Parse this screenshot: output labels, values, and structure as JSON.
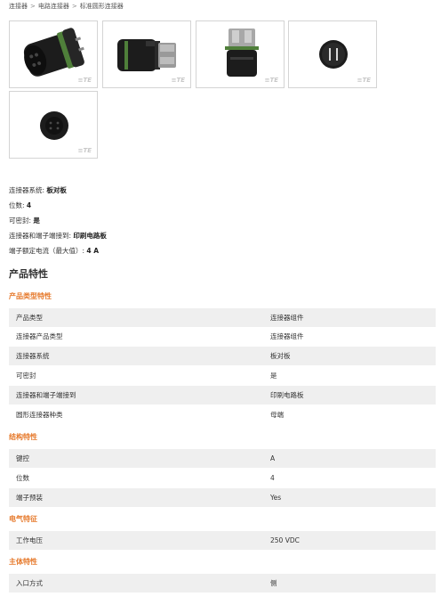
{
  "breadcrumb": [
    {
      "label": "连接器"
    },
    {
      "label": "电路连接器"
    },
    {
      "label": "标准圆形连接器"
    }
  ],
  "breadcrumb_separator": ">",
  "thumbnails": [
    {
      "icon": "connector-angled-view",
      "logo": "≡TE"
    },
    {
      "icon": "connector-side-view",
      "logo": "≡TE"
    },
    {
      "icon": "connector-top-view",
      "logo": "≡TE"
    },
    {
      "icon": "connector-face-two-pin",
      "logo": "≡TE"
    },
    {
      "icon": "connector-face-round",
      "logo": "≡TE"
    }
  ],
  "summary": [
    {
      "label": "连接器系统:",
      "value": "板对板"
    },
    {
      "label": "位数:",
      "value": "4"
    },
    {
      "label": "可密封:",
      "value": "是"
    },
    {
      "label": "连接器和端子端接到:",
      "value": "印刷电路板"
    },
    {
      "label": "端子额定电流（最大值）:",
      "value": "4 A"
    }
  ],
  "section_title": "产品特性",
  "groups": [
    {
      "title": "产品类型特性",
      "rows": [
        {
          "key": "产品类型",
          "value": "连接器组件"
        },
        {
          "key": "连接器产品类型",
          "value": "连接器组件"
        },
        {
          "key": "连接器系统",
          "value": "板对板"
        },
        {
          "key": "可密封",
          "value": "是"
        },
        {
          "key": "连接器和端子端接到",
          "value": "印刷电路板"
        },
        {
          "key": "圆形连接器种类",
          "value": "母端"
        }
      ]
    },
    {
      "title": "结构特性",
      "rows": [
        {
          "key": "键控",
          "value": "A"
        },
        {
          "key": "位数",
          "value": "4"
        },
        {
          "key": "端子预装",
          "value": "Yes"
        }
      ]
    },
    {
      "title": "电气特征",
      "rows": [
        {
          "key": "工作电压",
          "value": "250 VDC"
        }
      ]
    },
    {
      "title": "主体特性",
      "rows": [
        {
          "key": "入口方式",
          "value": "侧"
        }
      ]
    }
  ],
  "colors": {
    "group_title": "#e6792b",
    "row_shade": "#efefef",
    "connector_body": "#1a1a1a",
    "seal_green": "#4f7f3a"
  }
}
